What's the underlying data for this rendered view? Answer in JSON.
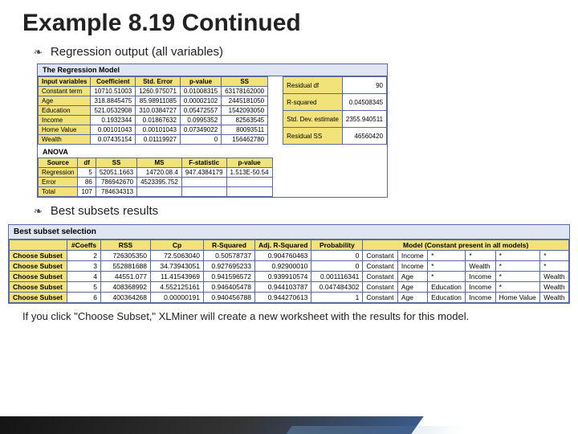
{
  "title": "Example 8.19 Continued",
  "bullets": {
    "regression": "Regression output (all variables)",
    "subsets": "Best subsets results"
  },
  "footnote": "If you click \"Choose Subset,\" XLMiner will create a new worksheet with the results for this model.",
  "reg": {
    "header": "The Regression Model",
    "cols": {
      "iv": "Input variables",
      "coef": "Coefficient",
      "se": "Std. Error",
      "p": "p-value",
      "ss": "SS"
    },
    "rows": [
      {
        "iv": "Constant term",
        "coef": "10710.51003",
        "se": "1260.975071",
        "p": "0.01008315",
        "ss": "63178162000"
      },
      {
        "iv": "Age",
        "coef": "318.8845475",
        "se": "85.98911085",
        "p": "0.00002102",
        "ss": "2445181050"
      },
      {
        "iv": "Education",
        "coef": "521.0532908",
        "se": "310.0384727",
        "p": "0.05472557",
        "ss": "1542093050"
      },
      {
        "iv": "Income",
        "coef": "0.1932344",
        "se": "0.01867632",
        "p": "0.0995352",
        "ss": "82563545"
      },
      {
        "iv": "Home Value",
        "coef": "0.00101043",
        "se": "0.00101043",
        "p": "0.07349022",
        "ss": "80093511"
      },
      {
        "iv": "Wealth",
        "coef": "0.07435154",
        "se": "0.01119927",
        "p": "0",
        "ss": "156462780"
      }
    ],
    "side": {
      "rdf": {
        "k": "Residual df",
        "v": "90"
      },
      "r2": {
        "k": "R-squared",
        "v": "0.04508345"
      },
      "sde": {
        "k": "Std. Dev. estimate",
        "v": "2355.940511"
      },
      "rss": {
        "k": "Residual SS",
        "v": "46560420"
      }
    }
  },
  "anova": {
    "label": "ANOVA",
    "cols": {
      "src": "Source",
      "df": "df",
      "ss": "SS",
      "ms": "MS",
      "f": "F-statistic",
      "p": "p-value"
    },
    "rows": [
      {
        "src": "Regression",
        "df": "5",
        "ss": "52051.1663",
        "ms": "14720.08.4",
        "f": "947.4384179",
        "p": "1.513E-50.54"
      },
      {
        "src": "Error",
        "df": "86",
        "ss": "786942670",
        "ms": "4523395.752",
        "f": "",
        "p": ""
      },
      {
        "src": "Total",
        "df": "107",
        "ss": "784634313",
        "ms": "",
        "f": "",
        "p": ""
      }
    ]
  },
  "subset": {
    "header": "Best subset selection",
    "cols": {
      "nc": "#Coeffs",
      "rss": "RSS",
      "cp": "Cp",
      "r2": "R-Squared",
      "ar2": "Adj. R-Squared",
      "prob": "Probability",
      "model": "Model (Constant present in all models)"
    },
    "rowlabel": "Choose Subset",
    "rows": [
      {
        "nc": "2",
        "rss": "726305350",
        "cp": "72.5063040",
        "r2": "0.50578737",
        "ar2": "0.904760463",
        "prob": "0",
        "m": [
          "Constant",
          "Income",
          "*",
          "*",
          "*",
          "*"
        ]
      },
      {
        "nc": "3",
        "rss": "552881688",
        "cp": "34.73943051",
        "r2": "0.927695233",
        "ar2": "0.92900010",
        "prob": "0",
        "m": [
          "Constant",
          "Income",
          "*",
          "Wealth",
          "*",
          "*"
        ]
      },
      {
        "nc": "4",
        "rss": "44551.077",
        "cp": "11.41543969",
        "r2": "0.941596572",
        "ar2": "0.939910574",
        "prob": "0.001116341",
        "m": [
          "Constant",
          "Age",
          "*",
          "Income",
          "*",
          "Wealth"
        ]
      },
      {
        "nc": "5",
        "rss": "408368992",
        "cp": "4.552125161",
        "r2": "0.946405478",
        "ar2": "0.944103787",
        "prob": "0.047484302",
        "m": [
          "Constant",
          "Age",
          "Education",
          "Income",
          "*",
          "Wealth"
        ]
      },
      {
        "nc": "6",
        "rss": "400364268",
        "cp": "0.00000191",
        "r2": "0.940456788",
        "ar2": "0.944270613",
        "prob": "1",
        "m": [
          "Constant",
          "Age",
          "Education",
          "Income",
          "Home Value",
          "Wealth"
        ]
      }
    ]
  }
}
